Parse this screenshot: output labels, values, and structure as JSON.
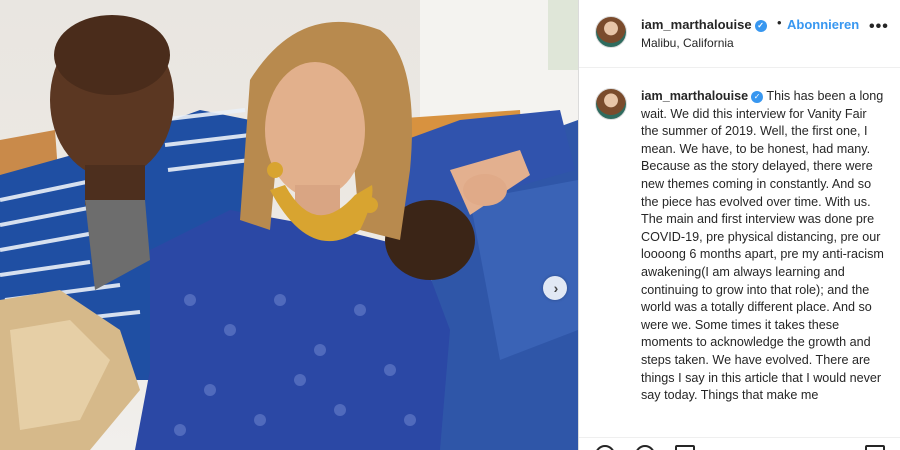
{
  "post": {
    "username": "iam_marthalouise",
    "verified_mark": "✓",
    "dot_separator": "•",
    "follow_label": "Abonnieren",
    "location": "Malibu, California",
    "more_glyph": "•••"
  },
  "caption": {
    "username": "iam_marthalouise",
    "verified_mark": "✓",
    "text": "This has been a long wait. We did this interview for Vanity Fair the summer of 2019. Well, the first one, I mean. We have, to be honest, had many. Because as the story delayed, there were new themes coming in constantly. And so the piece has evolved over time. With us. The main and first interview was done pre COVID-19, pre physical distancing, pre our loooong 6 months apart, pre my anti-racism awakening(I am always learning and continuing to grow into that role); and the world was a totally different place. And so were we. Some times it takes these moments to acknowledge the growth and steps taken. We have evolved. There are things I say in this article that I would never say today. Things that make me"
  },
  "carousel": {
    "next_glyph": "›"
  },
  "icons": {
    "avatar": "profile-avatar",
    "next": "chevron-right-icon",
    "more": "more-options-icon",
    "like": "heart-icon",
    "comment": "comment-icon",
    "share": "share-icon",
    "save": "bookmark-icon"
  },
  "colors": {
    "accent": "#3897f0",
    "text": "#262626",
    "border": "#dbdbdb"
  }
}
